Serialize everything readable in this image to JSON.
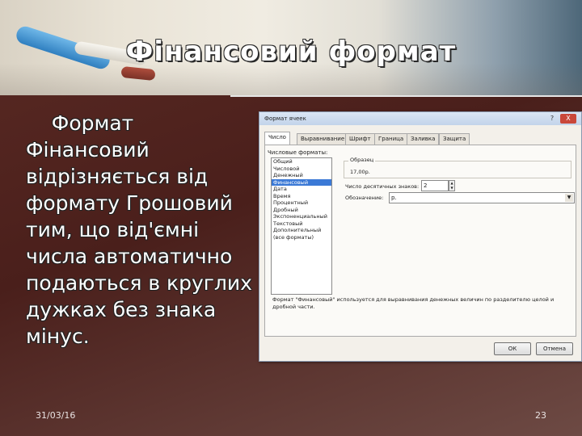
{
  "slide": {
    "title": "Фінансовий формат",
    "body": "    Формат Фінансовий відрізняється від формату Грошовий тим, що від'ємні  числа автоматично подаються в круглих дужках без знака мінус.",
    "date": "31/03/16",
    "page_number": "23"
  },
  "dialog": {
    "title": "Формат ячеек",
    "help_label": "?",
    "close_label": "X",
    "tabs": [
      "Число",
      "Выравнивание",
      "Шрифт",
      "Граница",
      "Заливка",
      "Защита"
    ],
    "active_tab": "Число",
    "category_label": "Числовые форматы:",
    "categories": [
      "Общий",
      "Числовой",
      "Денежный",
      "Финансовый",
      "Дата",
      "Время",
      "Процентный",
      "Дробный",
      "Экспоненциальный",
      "Текстовый",
      "Дополнительный",
      "(все форматы)"
    ],
    "selected_category": "Финансовый",
    "sample_label": "Образец",
    "sample_value": "17,00р.",
    "decimals_label": "Число десятичных знаков:",
    "decimals_value": "2",
    "symbol_label": "Обозначение:",
    "symbol_value": "р.",
    "description": "Формат \"Финансовый\" используется для выравнивания денежных величин по разделителю целой и дробной части.",
    "ok_label": "ОК",
    "cancel_label": "Отмена"
  },
  "colors": {
    "selection": "#3b79d6",
    "title_text": "#ffffff",
    "background": "#4a1f1b"
  }
}
